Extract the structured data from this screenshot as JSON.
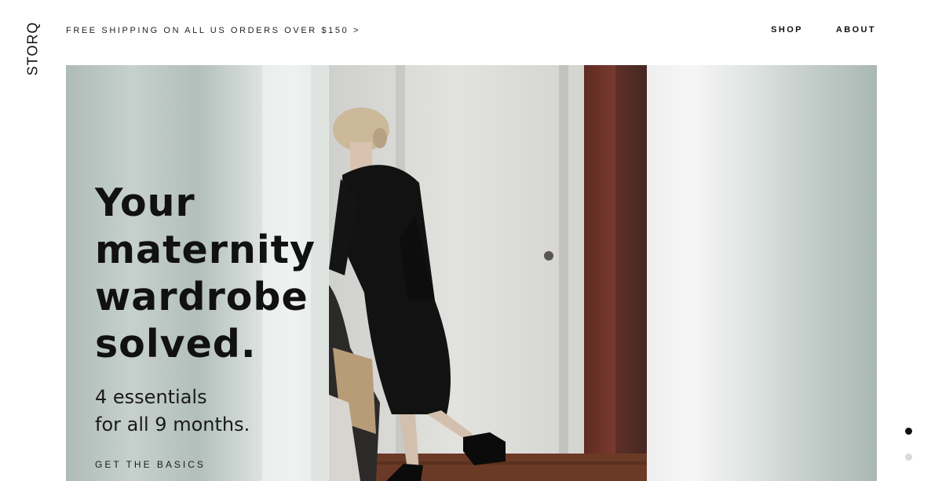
{
  "brand": {
    "logo_text": "STORQ"
  },
  "promo": {
    "text": "FREE SHIPPING ON ALL US ORDERS OVER $150 >"
  },
  "nav": {
    "items": [
      {
        "label": "SHOP"
      },
      {
        "label": "ABOUT"
      }
    ]
  },
  "hero": {
    "headline_lines": [
      "Your",
      "maternity",
      "wardrobe",
      "solved."
    ],
    "subtitle_lines": [
      "4 essentials",
      "for all 9 months."
    ],
    "cta_label": "GET THE BASICS"
  },
  "slider": {
    "slide_count": 2,
    "active_slide": 1
  },
  "colors": {
    "text": "#111111",
    "background": "#ffffff",
    "hero_tint": "#b9c4bf",
    "dot_inactive": "#d9d9d9"
  }
}
